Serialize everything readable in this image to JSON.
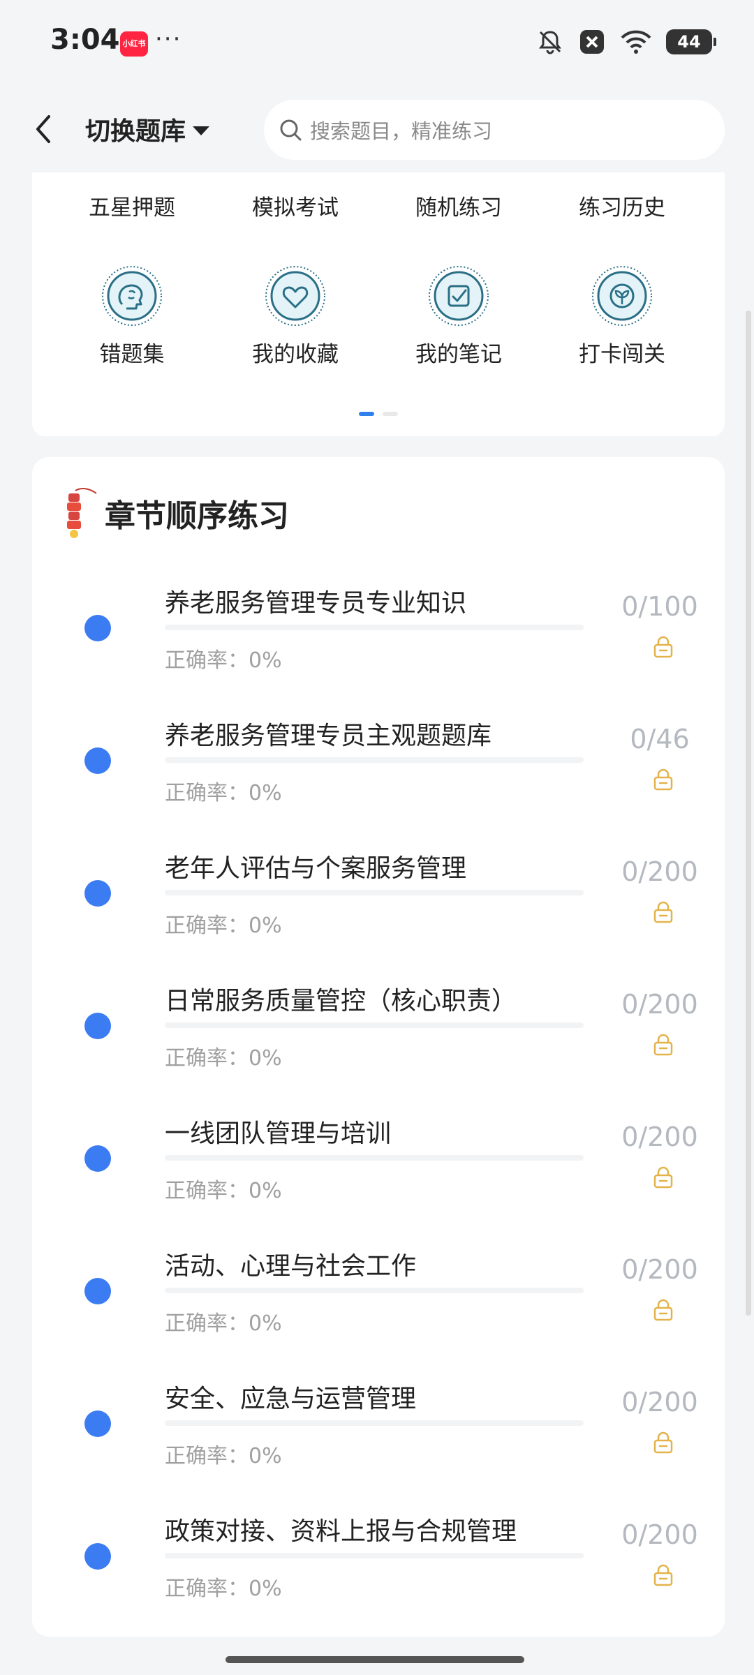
{
  "status_bar": {
    "time": "3:04",
    "app_badge": "小红书",
    "more": "···",
    "battery": "44",
    "icons": [
      "bell-off-icon",
      "close-box-icon",
      "wifi-icon",
      "battery-icon"
    ]
  },
  "header": {
    "bank_switch_label": "切换题库",
    "search_placeholder": "搜索题目，精准练习"
  },
  "grid": {
    "row1": [
      "五星押题",
      "模拟考试",
      "随机练习",
      "练习历史"
    ],
    "row2": [
      {
        "label": "错题集",
        "icon": "brain-icon"
      },
      {
        "label": "我的收藏",
        "icon": "heart-icon"
      },
      {
        "label": "我的笔记",
        "icon": "note-check-icon"
      },
      {
        "label": "打卡闯关",
        "icon": "sprout-icon"
      }
    ],
    "page": 1,
    "pages": 2
  },
  "chapter_section": {
    "title": "章节顺序练习",
    "accuracy_label": "正确率：",
    "chapters": [
      {
        "name": "养老服务管理专员专业知识",
        "accuracy": "0%",
        "count": "0/100",
        "progress": 0
      },
      {
        "name": "养老服务管理专员主观题题库",
        "accuracy": "0%",
        "count": "0/46",
        "progress": 0
      },
      {
        "name": "老年人评估与个案服务管理",
        "accuracy": "0%",
        "count": "0/200",
        "progress": 0
      },
      {
        "name": "日常服务质量管控（核心职责）",
        "accuracy": "0%",
        "count": "0/200",
        "progress": 0
      },
      {
        "name": "一线团队管理与培训",
        "accuracy": "0%",
        "count": "0/200",
        "progress": 0
      },
      {
        "name": "活动、心理与社会工作",
        "accuracy": "0%",
        "count": "0/200",
        "progress": 0
      },
      {
        "name": "安全、应急与运营管理",
        "accuracy": "0%",
        "count": "0/200",
        "progress": 0
      },
      {
        "name": "政策对接、资料上报与合规管理",
        "accuracy": "0%",
        "count": "0/200",
        "progress": 0
      }
    ]
  },
  "colors": {
    "accent": "#3b7cf3",
    "lock": "#e3b34a",
    "icon_teal": "#2a6f86",
    "icon_bg": "#e3f3f8"
  }
}
